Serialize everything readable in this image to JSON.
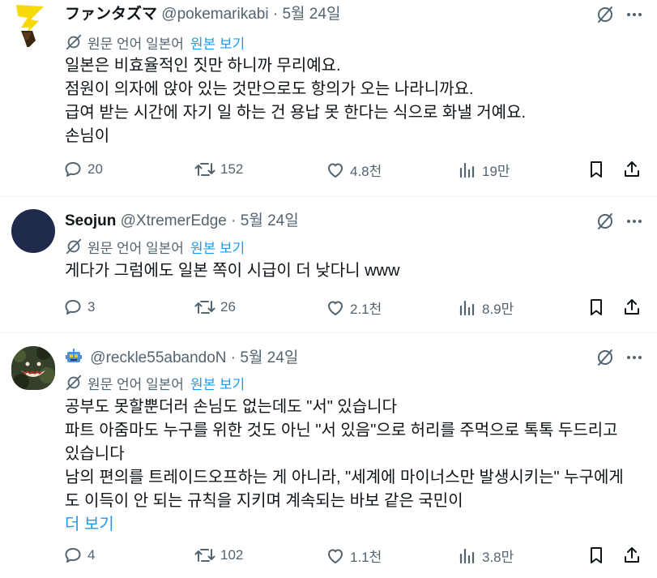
{
  "translation_label": "원문 언어 일본어",
  "translation_link": "원본 보기",
  "tweets": [
    {
      "name": "ファンタズマ",
      "handle": "@pokemarikabi",
      "date": "5월 24일",
      "lines": [
        "일본은 비효율적인 짓만 하니까 무리예요.",
        "점원이 의자에 앉아 있는 것만으로도 항의가 오는 나라니까요.",
        "급여 받는 시간에 자기 일 하는 건 용납 못 한다는 식으로 화낼 거예요.",
        "손님이"
      ],
      "replies": "20",
      "reposts": "152",
      "likes": "4.8천",
      "views": "19만"
    },
    {
      "name": "Seojun",
      "handle": "@XtremerEdge",
      "date": "5월 24일",
      "lines": [
        "게다가 그럼에도 일본 쪽이 시급이 더 낮다니 www"
      ],
      "replies": "3",
      "reposts": "26",
      "likes": "2.1천",
      "views": "8.9만"
    },
    {
      "name": "",
      "handle": "@reckle55abandoN",
      "date": "5월 24일",
      "lines": [
        "공부도 못할뿐더러 손님도 없는데도 \"서\" 있습니다",
        "파트 아줌마도 누구를 위한 것도 아닌 \"서 있음\"으로 허리를 주먹으로 톡톡 두드리고",
        "있습니다",
        "남의 편의를 트레이드오프하는 게 아니라, \"세계에 마이너스만 발생시키는\" 누구에게",
        "도 이득이 안 되는 규칙을 지키며 계속되는 바보 같은 국민이"
      ],
      "show_more": "더 보기",
      "replies": "4",
      "reposts": "102",
      "likes": "1.1천",
      "views": "3.8만"
    }
  ],
  "colors": {
    "text": "#0f1419",
    "secondary": "#536471",
    "link": "#1d9bf0",
    "divider": "#eff3f4"
  },
  "icons": [
    "grok-icon",
    "more-icon",
    "translate-icon",
    "reply-icon",
    "repost-icon",
    "like-icon",
    "views-icon",
    "bookmark-icon",
    "share-icon"
  ]
}
